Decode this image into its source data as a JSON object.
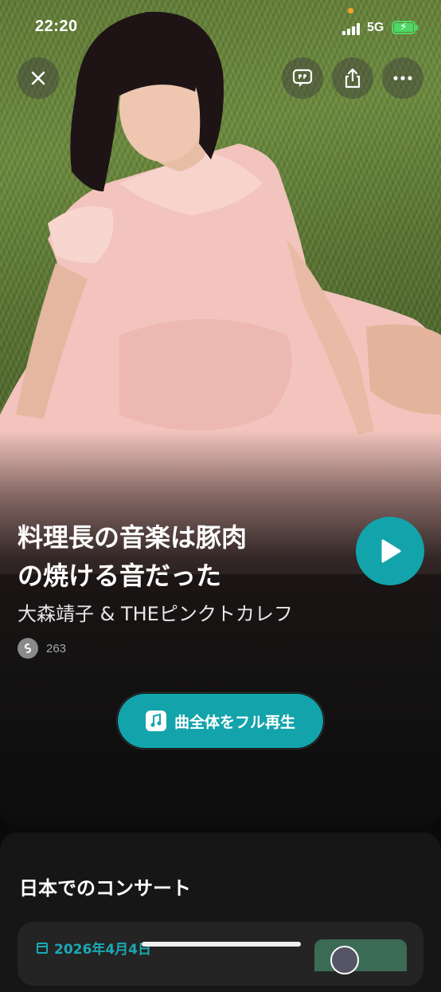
{
  "status_bar": {
    "time": "22:20",
    "network": "5G"
  },
  "colors": {
    "accent": "#13a3ab",
    "background": "#0d0d0d",
    "battery": "#4cd964"
  },
  "header": {
    "close_icon": "close-icon",
    "lyrics_icon": "quote-bubble-icon",
    "share_icon": "share-icon",
    "more_icon": "ellipsis-icon"
  },
  "track": {
    "title_line1": "料理長の音楽は豚肉",
    "title_line2": "の焼ける音だった",
    "artist": "大森靖子 & THEピンクトカレフ",
    "shazam_count": "263"
  },
  "actions": {
    "play_icon": "play-icon",
    "full_play_label": "曲全体をフル再生"
  },
  "concerts": {
    "section_title": "日本でのコンサート",
    "items": [
      {
        "date": "2026年4月4日"
      }
    ]
  }
}
